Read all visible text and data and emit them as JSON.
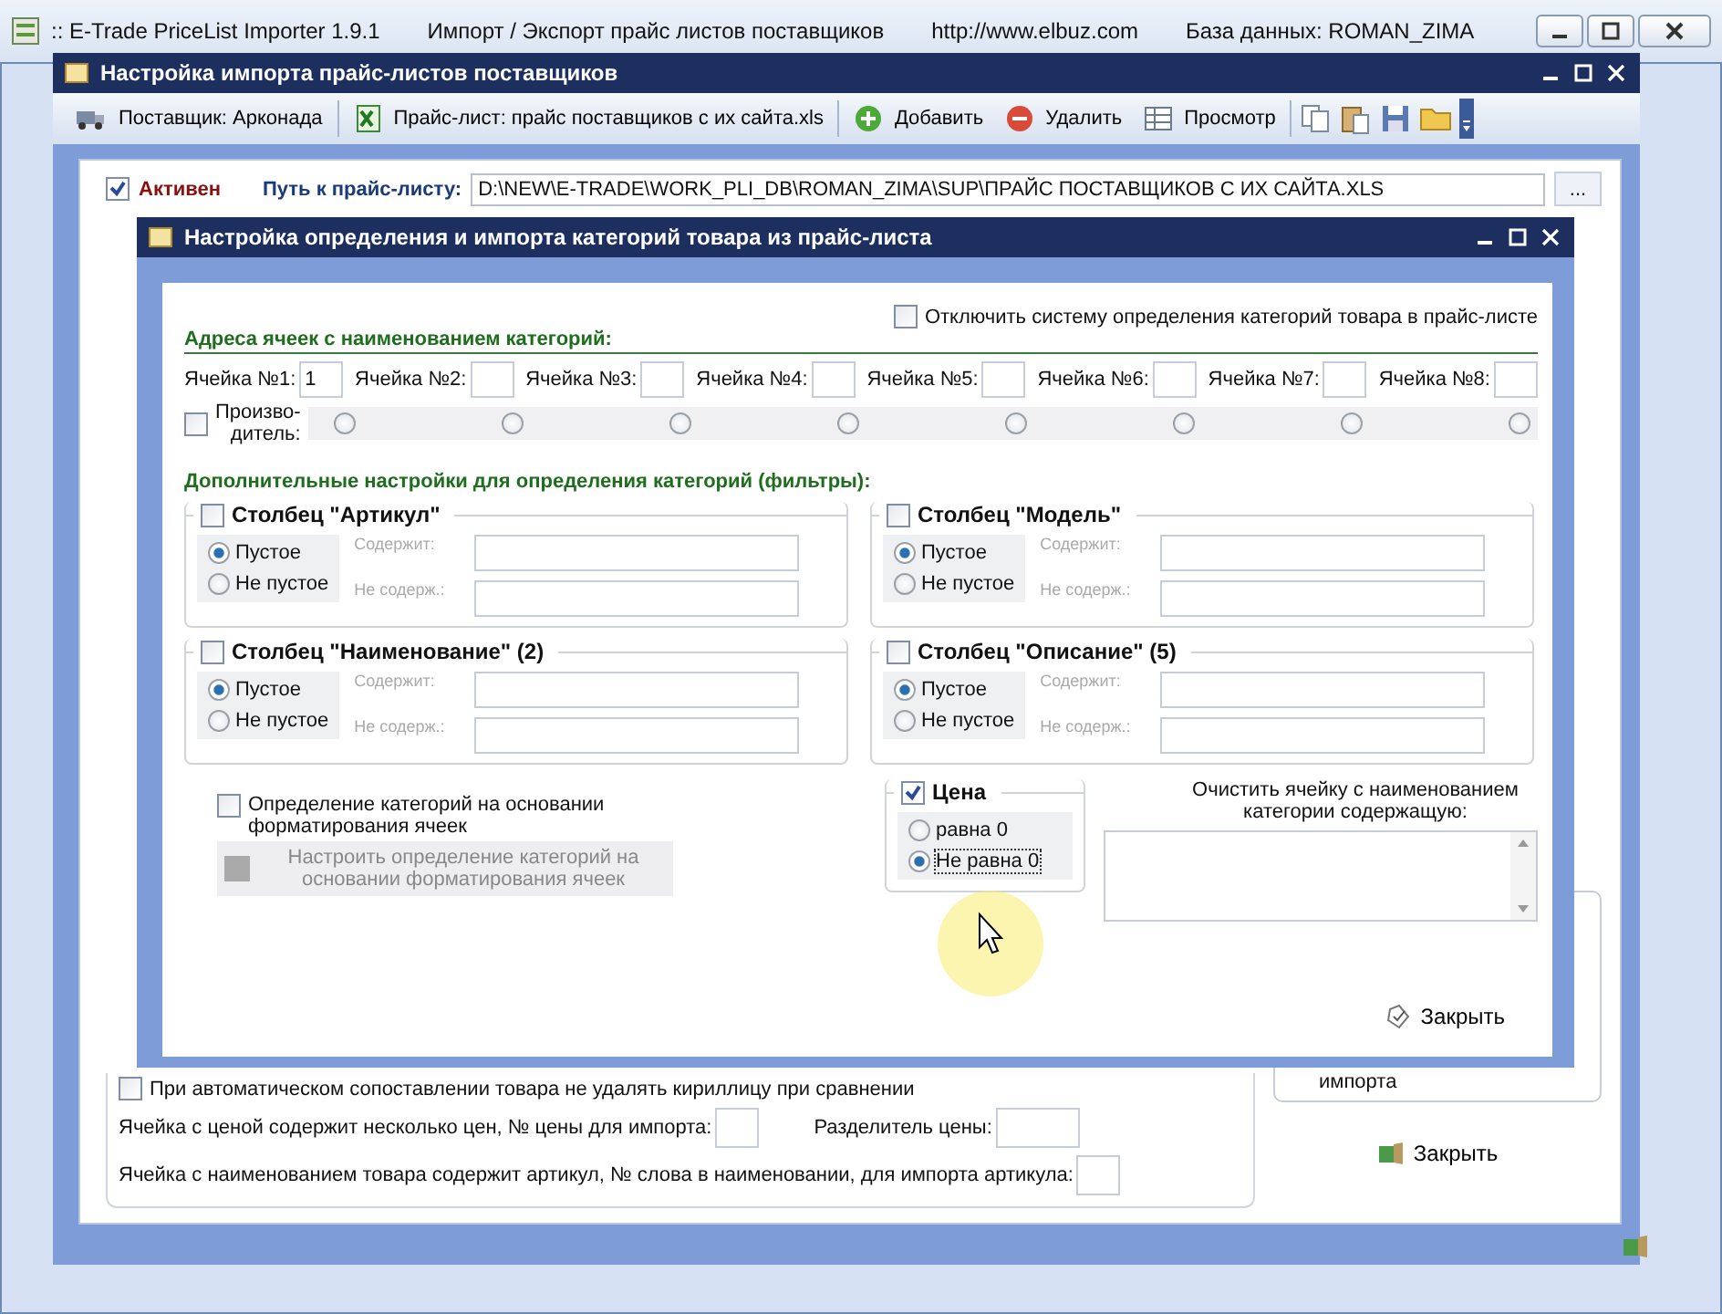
{
  "app_window": {
    "title_parts": [
      ":: E-Trade PriceList Importer 1.9.1",
      "Импорт / Экспорт прайс листов поставщиков",
      "http://www.elbuz.com",
      "База данных: ROMAN_ZIMA"
    ]
  },
  "import_window": {
    "title": "Настройка импорта прайс-листов поставщиков",
    "toolbar": [
      {
        "kind": "truck",
        "label": "Поставщик: Арконада"
      },
      {
        "kind": "sheet",
        "label": "Прайс-лист: прайс поставщиков с их сайта.xls"
      },
      {
        "kind": "add",
        "label": "Добавить"
      },
      {
        "kind": "delete",
        "label": "Удалить"
      },
      {
        "kind": "view",
        "label": "Просмотр"
      },
      {
        "kind": "copy"
      },
      {
        "kind": "paste"
      },
      {
        "kind": "save"
      },
      {
        "kind": "folder"
      }
    ],
    "active": {
      "label": "Активен",
      "checked": true
    },
    "path_label": "Путь к прайс-листу:",
    "path_value": "D:\\NEW\\E-TRADE\\WORK_PLI_DB\\ROMAN_ZIMA\\SUP\\ПРАЙС ПОСТАВЩИКОВ С ИХ САЙТА.XLS",
    "browse_button": "...",
    "cyrillic_option": {
      "label": "При автоматическом сопоставлении товара не удалять кириллицу при сравнении",
      "checked": false
    },
    "field_rows": [
      [
        {
          "label": "Ячейка с ценой содержит несколько цен, № цены для импорта:"
        },
        {
          "label": "Разделитель цены:"
        }
      ],
      [
        {
          "label": "Ячейка с наименованием товара содержит артикул, № слова в наименовании, для импорта артикула:"
        }
      ]
    ],
    "side_text": "импорта",
    "close_button": "Закрыть"
  },
  "category_dialog": {
    "title": "Настройка определения и импорта категорий товара из прайс-листа",
    "disable_option": {
      "label": "Отключить систему определения категорий товара в прайс-листе",
      "checked": false
    },
    "cells_heading": "Адреса ячеек с наименованием категорий:",
    "cells": [
      {
        "label": "Ячейка №1:",
        "value": "1"
      },
      {
        "label": "Ячейка №2:"
      },
      {
        "label": "Ячейка №3:"
      },
      {
        "label": "Ячейка №4:"
      },
      {
        "label": "Ячейка №5:"
      },
      {
        "label": "Ячейка №6:"
      },
      {
        "label": "Ячейка №7:"
      },
      {
        "label": "Ячейка №8:"
      }
    ],
    "producer": {
      "label_lines": [
        "Произво-",
        "дитель:"
      ],
      "checked": false,
      "radios": [
        {
          "selected": false
        },
        {
          "selected": false
        },
        {
          "selected": false
        },
        {
          "selected": false
        },
        {
          "selected": false
        },
        {
          "selected": false
        },
        {
          "selected": false
        },
        {
          "selected": false
        }
      ]
    },
    "filters_heading": "Дополнительные настройки для определения категорий (фильтры):",
    "filter_groups": [
      {
        "title": "Столбец \"Артикул\"",
        "checked": false,
        "options": [
          {
            "label": "Пустое",
            "selected": true
          },
          {
            "label": "Не пустое",
            "selected": false
          }
        ],
        "contains_label": "Содержит:",
        "not_contains_label": "Не содерж.:"
      },
      {
        "title": "Столбец \"Модель\"",
        "checked": false,
        "options": [
          {
            "label": "Пустое",
            "selected": true
          },
          {
            "label": "Не пустое",
            "selected": false
          }
        ],
        "contains_label": "Содержит:",
        "not_contains_label": "Не содерж.:"
      },
      {
        "title": "Столбец \"Наименование\" (2)",
        "checked": false,
        "options": [
          {
            "label": "Пустое",
            "selected": true
          },
          {
            "label": "Не пустое",
            "selected": false
          }
        ],
        "contains_label": "Содержит:",
        "not_contains_label": "Не содерж.:"
      },
      {
        "title": "Столбец \"Описание\" (5)",
        "checked": false,
        "options": [
          {
            "label": "Пустое",
            "selected": true
          },
          {
            "label": "Не пустое",
            "selected": false
          }
        ],
        "contains_label": "Содержит:",
        "not_contains_label": "Не содерж.:"
      }
    ],
    "format_option": {
      "label": "Определение категорий на основании форматирования ячеек",
      "checked": false
    },
    "format_button": {
      "label": "Настроить определение категорий на основании форматирования ячеек",
      "disabled": true
    },
    "price_group": {
      "title": "Цена",
      "checked": true,
      "options": [
        {
          "label": "равна 0",
          "selected": false
        },
        {
          "label": "Не равна 0",
          "selected": true
        }
      ]
    },
    "clear_label": "Очистить ячейку с наименованием категории содержащую:",
    "close_button": "Закрыть"
  }
}
